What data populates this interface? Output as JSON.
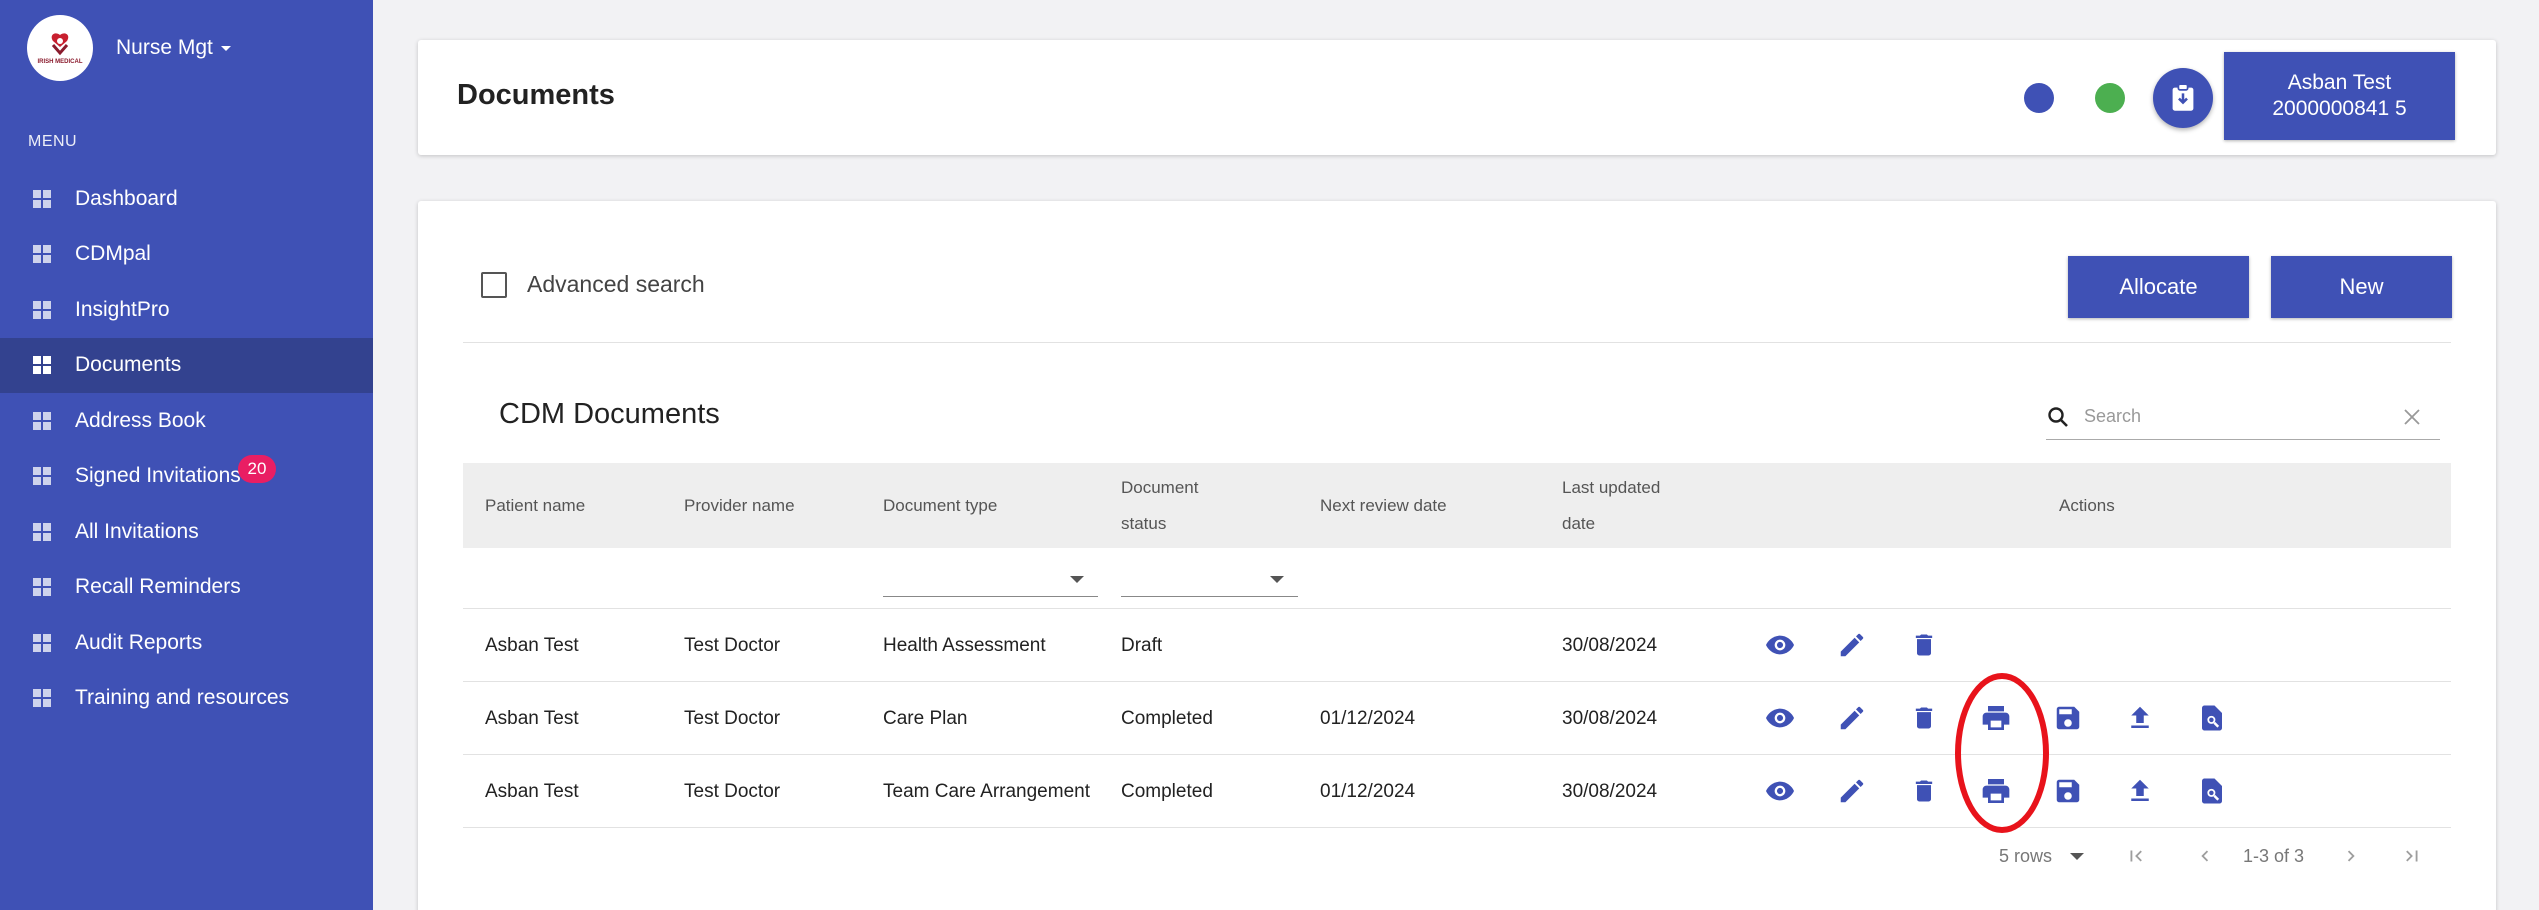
{
  "sidebar": {
    "brand_name": "Nurse Mgt",
    "logo_text": "IRISH MEDICAL",
    "menu_header": "MENU",
    "items": [
      {
        "label": "Dashboard"
      },
      {
        "label": "CDMpal"
      },
      {
        "label": "InsightPro"
      },
      {
        "label": "Documents",
        "active": true
      },
      {
        "label": "Address Book"
      },
      {
        "label": "Signed Invitations",
        "badge": "20"
      },
      {
        "label": "All Invitations"
      },
      {
        "label": "Recall Reminders"
      },
      {
        "label": "Audit Reports"
      },
      {
        "label": "Training and resources"
      }
    ]
  },
  "header": {
    "title": "Documents",
    "patient_name": "Asban Test",
    "patient_id": "2000000841 5",
    "status_colors": {
      "blue": "#3f51b5",
      "green": "#4caf50"
    }
  },
  "toolbar": {
    "advanced_search_label": "Advanced search",
    "allocate_label": "Allocate",
    "new_label": "New"
  },
  "table": {
    "title": "CDM Documents",
    "search_placeholder": "Search",
    "columns": {
      "patient": "Patient name",
      "provider": "Provider name",
      "doctype": "Document type",
      "status_l1": "Document",
      "status_l2": "status",
      "review": "Next review date",
      "updated_l1": "Last updated",
      "updated_l2": "date",
      "actions": "Actions"
    },
    "rows": [
      {
        "patient": "Asban Test",
        "provider": "Test Doctor",
        "doctype": "Health Assessment",
        "status": "Draft",
        "review": "",
        "updated": "30/08/2024"
      },
      {
        "patient": "Asban Test",
        "provider": "Test Doctor",
        "doctype": "Care Plan",
        "status": "Completed",
        "review": "01/12/2024",
        "updated": "30/08/2024"
      },
      {
        "patient": "Asban Test",
        "provider": "Test Doctor",
        "doctype": "Team Care Arrangement",
        "status": "Completed",
        "review": "01/12/2024",
        "updated": "30/08/2024"
      }
    ],
    "pagination": {
      "rows_per_page": "5 rows",
      "range": "1-3 of 3"
    }
  },
  "colors": {
    "primary": "#3f51b5",
    "sidebar_active": "#33428f",
    "badge": "#e91e63",
    "highlight": "#e8131b"
  }
}
